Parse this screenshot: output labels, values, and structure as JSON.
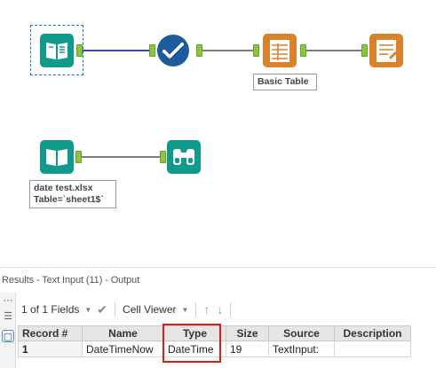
{
  "workflow": {
    "tools": [
      {
        "name": "text-input-tool",
        "icon": "book-open-icon"
      },
      {
        "name": "formula-tool",
        "icon": "check-circle-icon"
      },
      {
        "name": "table-tool",
        "icon": "table-doc-icon"
      },
      {
        "name": "render-tool",
        "icon": "document-edit-icon"
      },
      {
        "name": "input-data-tool",
        "icon": "book-open-icon"
      },
      {
        "name": "browse-tool",
        "icon": "binoculars-icon"
      }
    ],
    "annotations": {
      "basic_table": "Basic Table",
      "input_data": "date test.xlsx\nTable=`sheet1$`"
    }
  },
  "results": {
    "title": "Results - Text Input (11) - Output",
    "toolbar": {
      "fields": "1 of 1 Fields",
      "cell_viewer": "Cell Viewer"
    },
    "columns": [
      "Record #",
      "Name",
      "Type",
      "Size",
      "Source",
      "Description"
    ],
    "rows": [
      [
        "1",
        "DateTimeNow",
        "DateTime",
        "19",
        "TextInput:",
        ""
      ]
    ]
  },
  "colors": {
    "tool_teal": "#0f9a8c",
    "tool_blue": "#1d5a9e",
    "tool_orange": "#d9822b",
    "anchor_green": "#8cc63f",
    "highlight_red": "#d81e1e"
  }
}
